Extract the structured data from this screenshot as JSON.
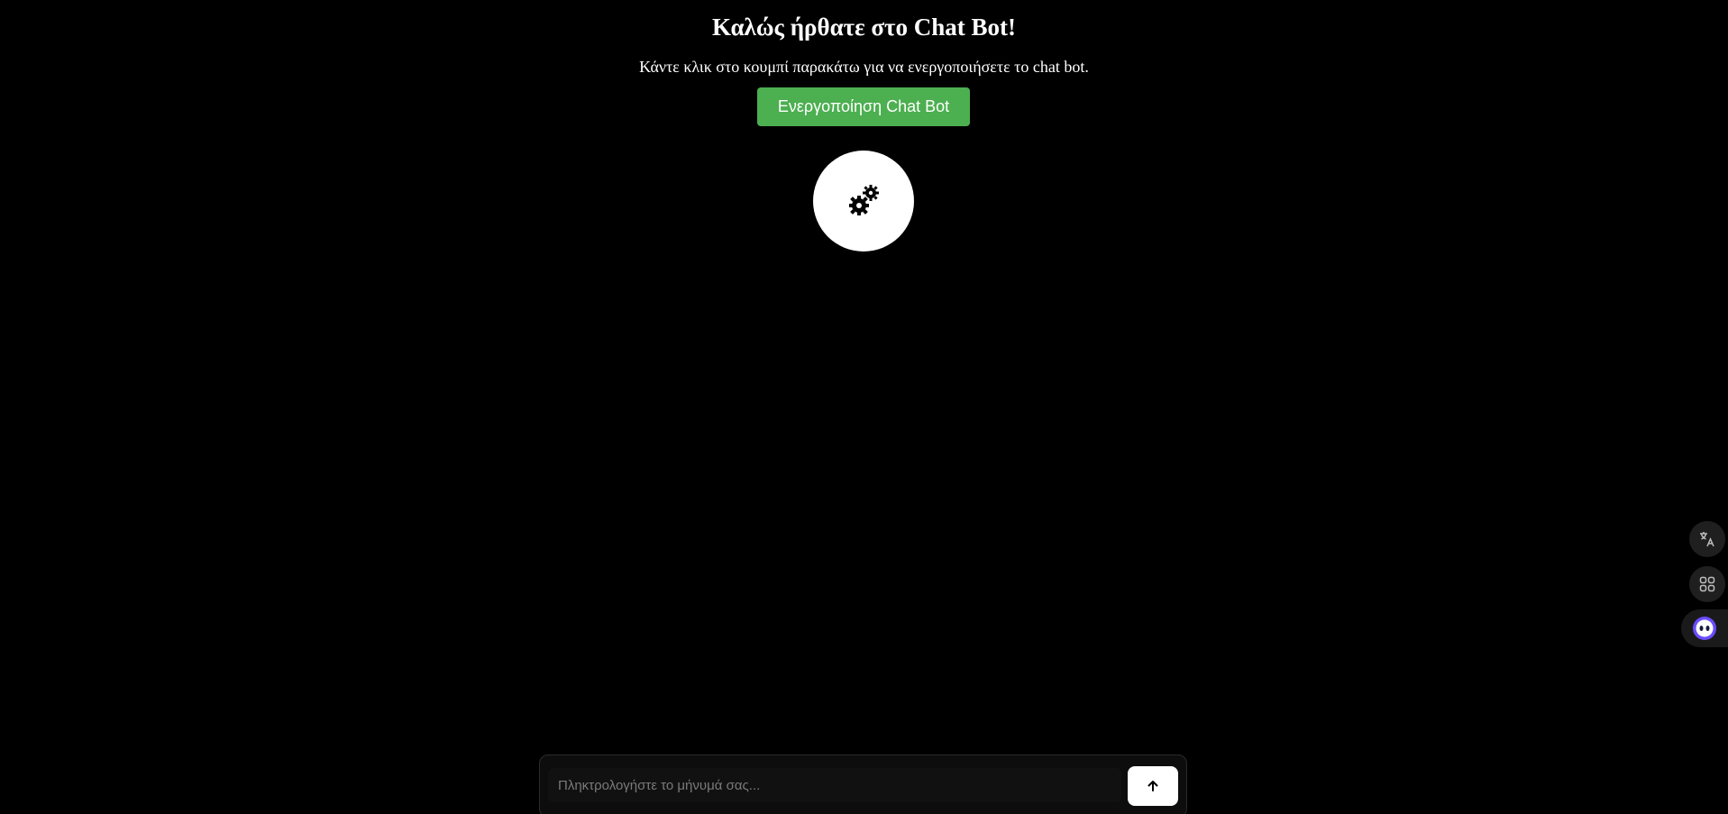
{
  "header": {
    "title": "Καλώς ήρθατε στο Chat Bot!",
    "subtitle": "Κάντε κλικ στο κουμπί παρακάτω για να ενεργοποιήσετε το chat bot."
  },
  "actions": {
    "activate_label": "Ενεργοποίηση Chat Bot"
  },
  "bot": {
    "icon": "gears-icon"
  },
  "side_toolbar": {
    "items": [
      "translate-icon",
      "apps-grid-icon",
      "assistant-face-icon"
    ]
  },
  "chat": {
    "placeholder": "Πληκτρολογήστε το μήνυμά σας...",
    "send_icon": "arrow-up-icon"
  },
  "colors": {
    "background": "#000000",
    "accent_button": "#4caf50",
    "assistant_brand": "#6b4cff"
  }
}
